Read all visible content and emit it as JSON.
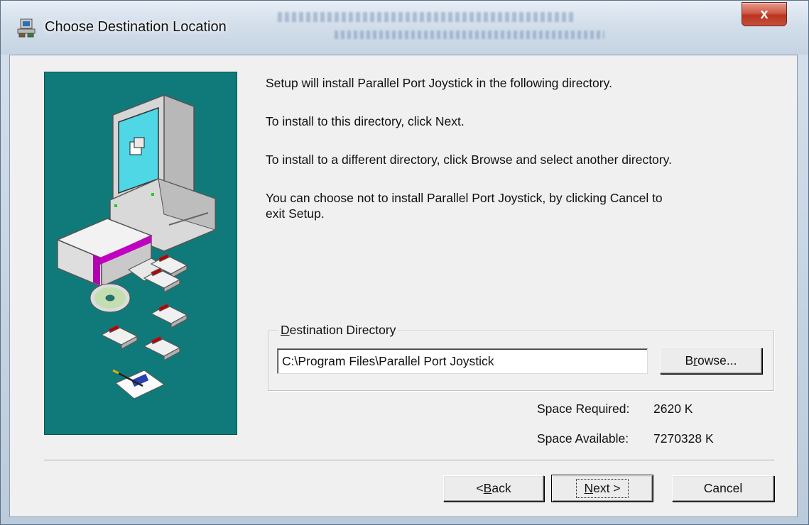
{
  "window": {
    "title": "Choose Destination Location",
    "icon": "setup-computer-icon",
    "close_label": "x"
  },
  "body": {
    "paragraphs": [
      "Setup will install Parallel Port Joystick in the following directory.",
      "To install to this directory, click Next.",
      "To install to a different directory, click Browse and select another directory.",
      "You can choose not to install Parallel Port Joystick, by clicking Cancel to\nexit Setup."
    ]
  },
  "destination": {
    "group_label_pre": "",
    "group_label_accel": "D",
    "group_label_post": "estination Directory",
    "path": "C:\\Program Files\\Parallel Port Joystick",
    "browse_pre": "B",
    "browse_accel": "r",
    "browse_post": "owse..."
  },
  "space": {
    "required_label": "Space Required:",
    "required_value": "2620 K",
    "available_label": "Space Available:",
    "available_value": "7270328 K"
  },
  "buttons": {
    "back_pre": "< ",
    "back_accel": "B",
    "back_post": "ack",
    "next_pre": "",
    "next_accel": "N",
    "next_post": "ext >",
    "cancel": "Cancel"
  },
  "colors": {
    "illustration_bg": "#107a7a",
    "close_button": "#c6503b",
    "dialog_bg": "#f0f0f0"
  }
}
